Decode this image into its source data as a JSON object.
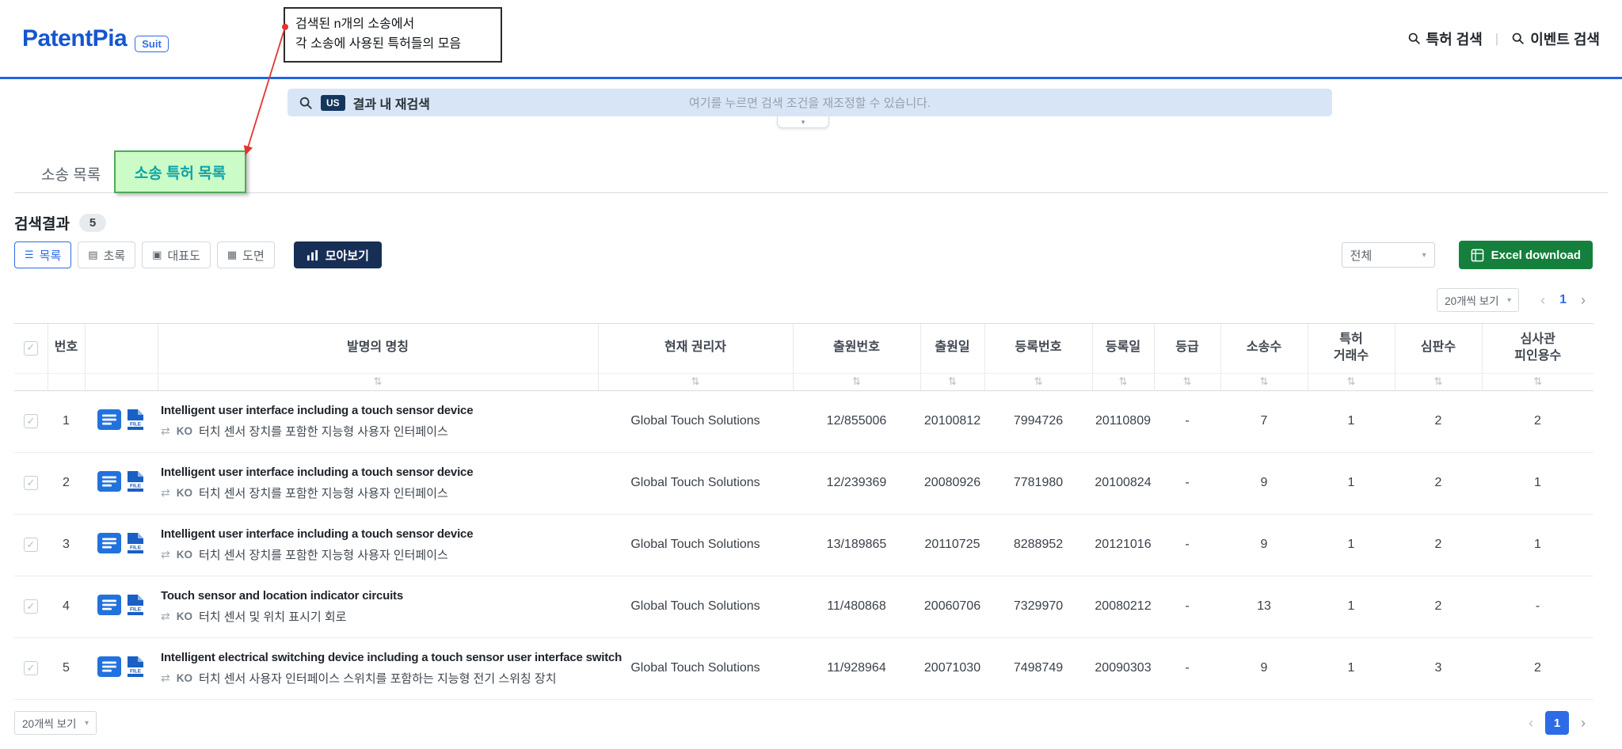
{
  "header": {
    "logo": "PatentPia",
    "logo_badge": "Suit",
    "nav": [
      {
        "label": "특허 검색"
      },
      {
        "label": "이벤트 검색"
      }
    ],
    "nav_separator": "|"
  },
  "annotation": {
    "line1": "검색된 n개의 소송에서",
    "line2": "각 소송에 사용된 특허들의 모음"
  },
  "search": {
    "country_badge": "US",
    "label": "결과 내 재검색",
    "placeholder": "여기를 누르면 검색 조건을 재조정할 수 있습니다."
  },
  "tabs": [
    {
      "label": "소송 목록",
      "active": false
    },
    {
      "label": "소송 특허 목록",
      "active": true
    }
  ],
  "results": {
    "label": "검색결과",
    "count": "5"
  },
  "toolbar": {
    "view_buttons": [
      {
        "key": "list",
        "label": "목록",
        "icon": "☰",
        "active": true
      },
      {
        "key": "abstract",
        "label": "초록",
        "icon": "▤",
        "active": false
      },
      {
        "key": "rep-figure",
        "label": "대표도",
        "icon": "▣",
        "active": false
      },
      {
        "key": "drawings",
        "label": "도면",
        "icon": "▦",
        "active": false
      }
    ],
    "collect_button": "모아보기",
    "filter_select": "전체",
    "excel_button": "Excel download"
  },
  "pagination": {
    "page_size": "20개씩 보기",
    "current_page": "1"
  },
  "icons": {
    "chevron_down": "▾",
    "sort": "⇅",
    "exchange": "⇄",
    "check": "✓",
    "prev": "‹",
    "next": "›"
  },
  "table": {
    "columns": [
      {
        "key": "no",
        "label": "번호",
        "sort": false
      },
      {
        "key": "docs",
        "label": "",
        "sort": false
      },
      {
        "key": "title",
        "label": "발명의 명칭",
        "sort": true
      },
      {
        "key": "owner",
        "label": "현재 권리자",
        "sort": true
      },
      {
        "key": "app_no",
        "label": "출원번호",
        "sort": true
      },
      {
        "key": "app_date",
        "label": "출원일",
        "sort": true
      },
      {
        "key": "reg_no",
        "label": "등록번호",
        "sort": true
      },
      {
        "key": "reg_date",
        "label": "등록일",
        "sort": true
      },
      {
        "key": "grade",
        "label": "등급",
        "sort": true
      },
      {
        "key": "suit_count",
        "label": "소송수",
        "sort": true
      },
      {
        "key": "deal_count",
        "label": "특허\n거래수",
        "sort": true
      },
      {
        "key": "trial_count",
        "label": "심판수",
        "sort": true
      },
      {
        "key": "citation_count",
        "label": "심사관\n피인용수",
        "sort": true
      }
    ],
    "rows": [
      {
        "no": "1",
        "title": "Intelligent user interface including a touch sensor device",
        "lang": "KO",
        "title_ko": "터치 센서 장치를 포함한 지능형 사용자 인터페이스",
        "owner": "Global Touch Solutions",
        "app_no": "12/855006",
        "app_date": "20100812",
        "reg_no": "7994726",
        "reg_date": "20110809",
        "grade": "-",
        "suit_count": "7",
        "deal_count": "1",
        "trial_count": "2",
        "citation_count": "2"
      },
      {
        "no": "2",
        "title": "Intelligent user interface including a touch sensor device",
        "lang": "KO",
        "title_ko": "터치 센서 장치를 포함한 지능형 사용자 인터페이스",
        "owner": "Global Touch Solutions",
        "app_no": "12/239369",
        "app_date": "20080926",
        "reg_no": "7781980",
        "reg_date": "20100824",
        "grade": "-",
        "suit_count": "9",
        "deal_count": "1",
        "trial_count": "2",
        "citation_count": "1"
      },
      {
        "no": "3",
        "title": "Intelligent user interface including a touch sensor device",
        "lang": "KO",
        "title_ko": "터치 센서 장치를 포함한 지능형 사용자 인터페이스",
        "owner": "Global Touch Solutions",
        "app_no": "13/189865",
        "app_date": "20110725",
        "reg_no": "8288952",
        "reg_date": "20121016",
        "grade": "-",
        "suit_count": "9",
        "deal_count": "1",
        "trial_count": "2",
        "citation_count": "1"
      },
      {
        "no": "4",
        "title": "Touch sensor and location indicator circuits",
        "lang": "KO",
        "title_ko": "터치 센서 및 위치 표시기 회로",
        "owner": "Global Touch Solutions",
        "app_no": "11/480868",
        "app_date": "20060706",
        "reg_no": "7329970",
        "reg_date": "20080212",
        "grade": "-",
        "suit_count": "13",
        "deal_count": "1",
        "trial_count": "2",
        "citation_count": "-"
      },
      {
        "no": "5",
        "title": "Intelligent electrical switching device including a touch sensor user interface switch",
        "lang": "KO",
        "title_ko": "터치 센서 사용자 인터페이스 스위치를 포함하는 지능형 전기 스위칭 장치",
        "owner": "Global Touch Solutions",
        "app_no": "11/928964",
        "app_date": "20071030",
        "reg_no": "7498749",
        "reg_date": "20090303",
        "grade": "-",
        "suit_count": "9",
        "deal_count": "1",
        "trial_count": "3",
        "citation_count": "2"
      }
    ]
  }
}
